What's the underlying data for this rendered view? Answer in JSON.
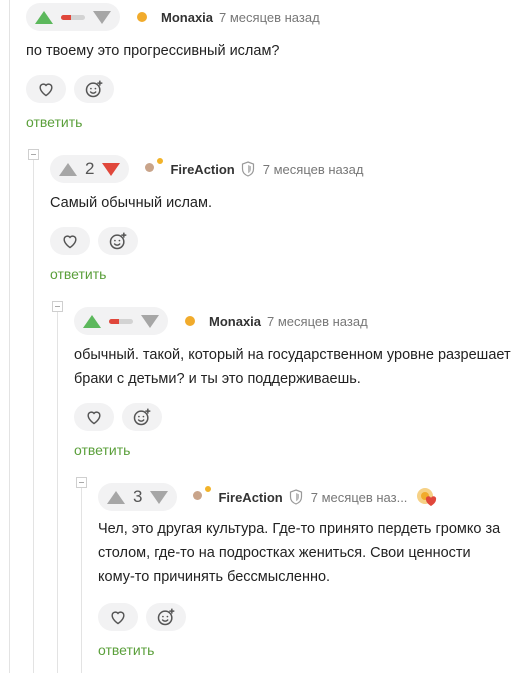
{
  "colors": {
    "upvote": "#5cb85c",
    "downvote": "#e0473b",
    "reply": "#5a9f3a",
    "meta": "#777777"
  },
  "comments": [
    {
      "author": "Monaxia",
      "time": "7 месяцев назад",
      "rating": "",
      "vote_state": "upvoted",
      "text": "по твоему это прогрессивный ислам?",
      "reply_label": "ответить",
      "icons": [
        "heart-icon",
        "smiley-add-icon"
      ]
    },
    {
      "author": "FireAction",
      "time": "7 месяцев назад",
      "rating": "2",
      "vote_state": "downvoted",
      "text": "Самый обычный ислам.",
      "reply_label": "ответить",
      "badge": "shield-icon"
    },
    {
      "author": "Monaxia",
      "time": "7 месяцев назад",
      "rating": "",
      "vote_state": "upvoted",
      "text": "обычный. такой, который на государственном уровне разрешает браки с детьми? и ты это поддерживаешь.",
      "reply_label": "ответить"
    },
    {
      "author": "FireAction",
      "time": "7 месяцев наз...",
      "rating": "3",
      "vote_state": "none",
      "text": "Чел, это другая культура. Где-то принято пердеть громко за столом, где-то на подростках жениться. Свои ценности кому-то причинять бессмысленно.",
      "reply_label": "ответить",
      "badge": "shield-icon",
      "award": "heart-award-icon"
    }
  ]
}
